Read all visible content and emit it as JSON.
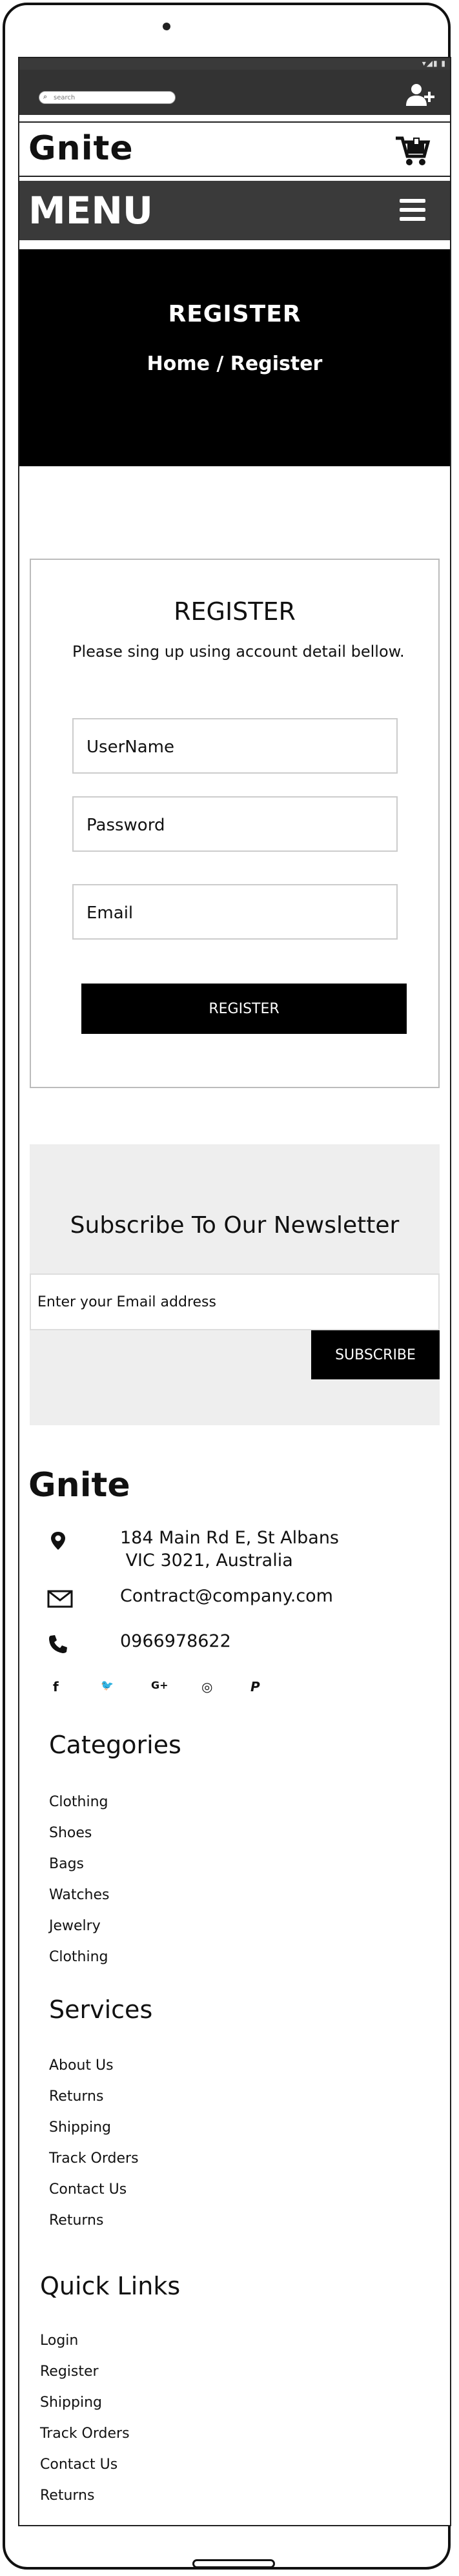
{
  "status": {
    "icons": "▾◢▮ ▮"
  },
  "search": {
    "placeholder": "search"
  },
  "header": {
    "logo": "Gnite",
    "menu": "MENU"
  },
  "hero": {
    "title": "REGISTER",
    "breadcrumb": "Home / Register"
  },
  "register": {
    "title": "REGISTER",
    "subtitle": "Please sing up using account detail bellow.",
    "username_placeholder": "UserName",
    "password_placeholder": "Password",
    "email_placeholder": "Email",
    "button": "REGISTER"
  },
  "newsletter": {
    "title": "Subscribe To Our Newsletter",
    "placeholder": "Enter your Email address",
    "button": "SUBSCRIBE"
  },
  "footer": {
    "logo": "Gnite",
    "address": "184 Main Rd E, St Albans\n VIC 3021, Australia",
    "email": "Contract@company.com",
    "phone": "0966978622",
    "social": [
      {
        "icon": "facebook-icon",
        "glyph": "f"
      },
      {
        "icon": "twitter-icon",
        "glyph": "🐦"
      },
      {
        "icon": "google-plus-icon",
        "glyph": "G+"
      },
      {
        "icon": "instagram-icon",
        "glyph": "◎"
      },
      {
        "icon": "paypal-icon",
        "glyph": "P"
      }
    ],
    "categories": {
      "title": "Categories",
      "items": [
        "Clothing",
        "Shoes",
        "Bags",
        "Watches",
        "Jewelry",
        "Clothing"
      ]
    },
    "services": {
      "title": "Services",
      "items": [
        "About Us",
        "Returns",
        "Shipping",
        "Track Orders",
        "Contact Us",
        "Returns"
      ]
    },
    "quick_links": {
      "title": "Quick Links",
      "items": [
        "Login",
        "Register",
        "Shipping",
        "Track Orders",
        "Contact Us",
        "Returns"
      ]
    }
  }
}
